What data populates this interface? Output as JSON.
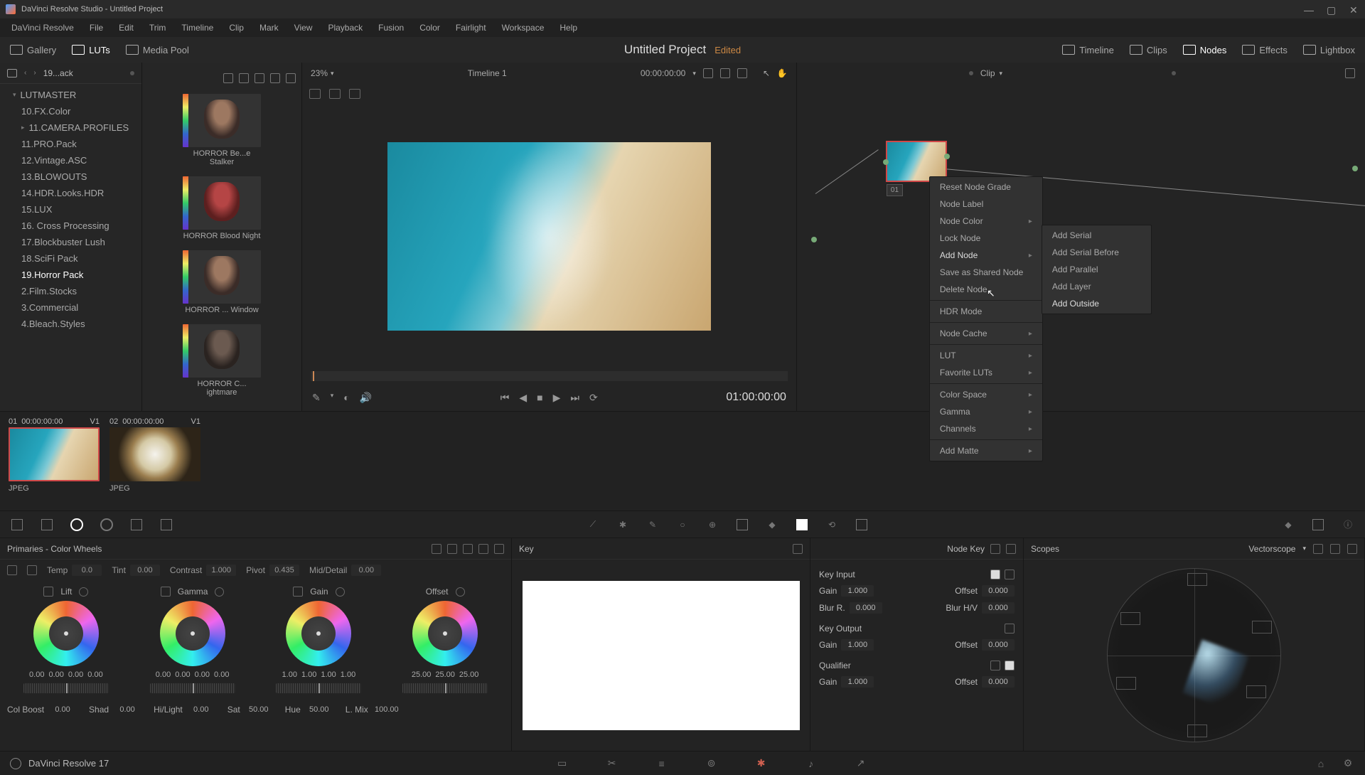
{
  "titlebar": {
    "text": "DaVinci Resolve Studio - Untitled Project"
  },
  "menubar": [
    "DaVinci Resolve",
    "File",
    "Edit",
    "Trim",
    "Timeline",
    "Clip",
    "Mark",
    "View",
    "Playback",
    "Fusion",
    "Color",
    "Fairlight",
    "Workspace",
    "Help"
  ],
  "subbar": {
    "gallery": "Gallery",
    "luts": "LUTs",
    "media_pool": "Media Pool",
    "project": "Untitled Project",
    "edited": "Edited",
    "timeline": "Timeline",
    "clips": "Clips",
    "nodes": "Nodes",
    "effects": "Effects",
    "lightbox": "Lightbox"
  },
  "sidebar": {
    "back": "19...ack",
    "root": "LUTMASTER",
    "items": [
      "10.FX.Color",
      "11.CAMERA.PROFILES",
      "11.PRO.Pack",
      "12.Vintage.ASC",
      "13.BLOWOUTS",
      "14.HDR.Looks.HDR",
      "15.LUX",
      "16. Cross Processing",
      "17.Blockbuster Lush",
      "18.SciFi Pack",
      "19.Horror Pack",
      "2.Film.Stocks",
      "3.Commercial",
      "4.Bleach.Styles"
    ]
  },
  "thumbs": [
    {
      "label": "HORROR Be...e Stalker"
    },
    {
      "label": "HORROR Blood Night"
    },
    {
      "label": "HORROR ... Window"
    },
    {
      "label": "HORROR C... ightmare"
    }
  ],
  "viewer": {
    "zoom": "23%",
    "timeline_name": "Timeline 1",
    "timecode_small": "00:00:00:00",
    "timecode": "01:00:00:00"
  },
  "nodes": {
    "header": "Clip",
    "num": "01"
  },
  "context_menu": [
    {
      "label": "Reset Node Grade"
    },
    {
      "label": "Node Label"
    },
    {
      "label": "Node Color",
      "arrow": true
    },
    {
      "label": "Lock Node"
    },
    {
      "label": "Add Node",
      "arrow": true,
      "hot": true
    },
    {
      "label": "Save as Shared Node"
    },
    {
      "label": "Delete Node"
    },
    {
      "sep": true
    },
    {
      "label": "HDR Mode"
    },
    {
      "sep": true
    },
    {
      "label": "Node Cache",
      "arrow": true
    },
    {
      "sep": true
    },
    {
      "label": "LUT",
      "arrow": true
    },
    {
      "label": "Favorite LUTs",
      "arrow": true
    },
    {
      "sep": true
    },
    {
      "label": "Color Space",
      "arrow": true
    },
    {
      "label": "Gamma",
      "arrow": true
    },
    {
      "label": "Channels",
      "arrow": true
    },
    {
      "sep": true
    },
    {
      "label": "Add Matte",
      "arrow": true
    }
  ],
  "sub_menu": [
    "Add Serial",
    "Add Serial Before",
    "Add Parallel",
    "Add Layer",
    "Add Outside"
  ],
  "clips": [
    {
      "idx": "01",
      "tc": "00:00:00:00",
      "v": "V1",
      "type": "JPEG"
    },
    {
      "idx": "02",
      "tc": "00:00:00:00",
      "v": "V1",
      "type": "JPEG"
    }
  ],
  "primaries": {
    "title": "Primaries - Color Wheels",
    "temp_row": {
      "temp_label": "Temp",
      "temp_val": "0.0",
      "tint_label": "Tint",
      "tint_val": "0.00",
      "contrast_label": "Contrast",
      "contrast_val": "1.000",
      "pivot_label": "Pivot",
      "pivot_val": "0.435",
      "md_label": "Mid/Detail",
      "md_val": "0.00"
    },
    "wheels": [
      {
        "name": "Lift",
        "vals": [
          "0.00",
          "0.00",
          "0.00",
          "0.00"
        ]
      },
      {
        "name": "Gamma",
        "vals": [
          "0.00",
          "0.00",
          "0.00",
          "0.00"
        ]
      },
      {
        "name": "Gain",
        "vals": [
          "1.00",
          "1.00",
          "1.00",
          "1.00"
        ]
      },
      {
        "name": "Offset",
        "vals": [
          "25.00",
          "25.00",
          "25.00"
        ]
      }
    ],
    "adj_row": {
      "cb": "Col Boost",
      "cb_v": "0.00",
      "shad": "Shad",
      "shad_v": "0.00",
      "hl": "Hi/Light",
      "hl_v": "0.00",
      "sat": "Sat",
      "sat_v": "50.00",
      "hue": "Hue",
      "hue_v": "50.00",
      "lmix": "L. Mix",
      "lmix_v": "100.00"
    }
  },
  "key_panel": {
    "title": "Key"
  },
  "keyparams": {
    "title": "Node Key",
    "key_input": "Key Input",
    "key_output": "Key Output",
    "qualifier": "Qualifier",
    "gain_label": "Gain",
    "offset_label": "Offset",
    "blur_r": "Blur R.",
    "blur_hv": "Blur H/V",
    "gain1": "1.000",
    "off1": "0.000",
    "blur_r_v": "0.000",
    "blur_hv_v": "0.000",
    "gain2": "1.000",
    "off2": "0.000",
    "gain3": "1.000",
    "off3": "0.000"
  },
  "scopes": {
    "title": "Scopes",
    "mode": "Vectorscope"
  },
  "footer": {
    "version": "DaVinci Resolve 17"
  }
}
